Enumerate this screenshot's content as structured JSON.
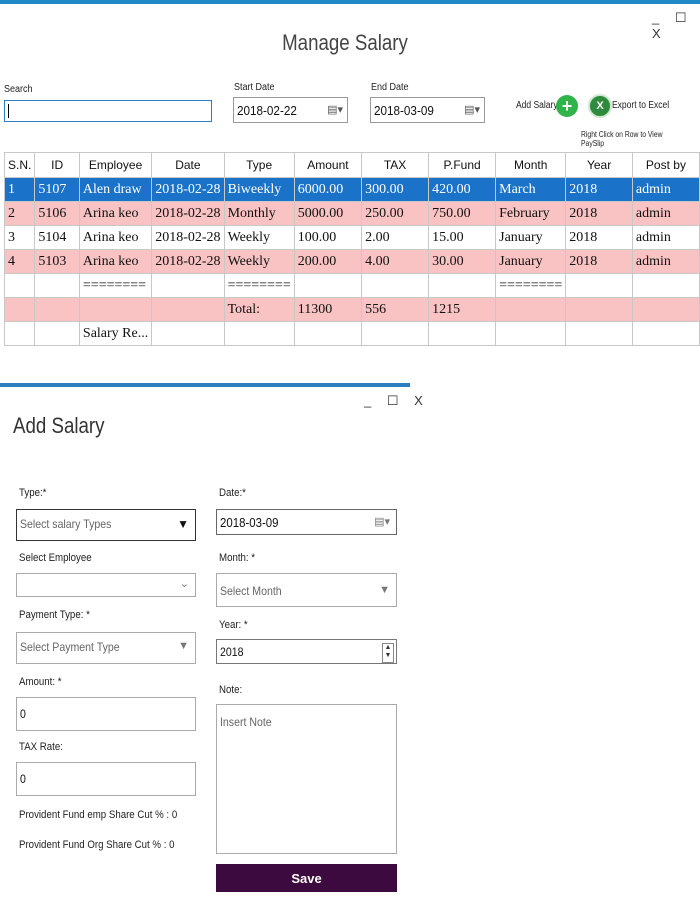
{
  "top_window": {
    "title": "Manage Salary",
    "controls": "_ ☐ X",
    "search_label": "Search",
    "search_value": "",
    "start_date_label": "Start Date",
    "start_date": "2018-02-22",
    "end_date_label": "End Date",
    "end_date": "2018-03-09",
    "add_salary_label": "Add Salary",
    "add_icon": "+",
    "export_icon": "X",
    "export_label": "Export to Excel",
    "hint": "Right Click on Row to View PaySlip"
  },
  "table": {
    "headers": [
      "S.N.",
      "ID",
      "Employee",
      "Date",
      "Type",
      "Amount",
      "TAX",
      "P.Fund",
      "Month",
      "Year",
      "Post by"
    ],
    "rows": [
      [
        "1",
        "5107",
        "Alen draw",
        "2018-02-28",
        "Biweekly",
        "6000.00",
        "300.00",
        "420.00",
        "March",
        "2018",
        "admin"
      ],
      [
        "2",
        "5106",
        "Arina keo",
        "2018-02-28",
        "Monthly",
        "5000.00",
        "250.00",
        "750.00",
        "February",
        "2018",
        "admin"
      ],
      [
        "3",
        "5104",
        "Arina keo",
        "2018-02-28",
        "Weekly",
        "100.00",
        "2.00",
        "15.00",
        "January",
        "2018",
        "admin"
      ],
      [
        "4",
        "5103",
        "Arina keo",
        "2018-02-28",
        "Weekly",
        "200.00",
        "4.00",
        "30.00",
        "January",
        "2018",
        "admin"
      ],
      [
        "",
        "",
        "========",
        "",
        "========",
        "",
        "",
        "",
        "========",
        "",
        ""
      ],
      [
        "",
        "",
        "",
        "",
        "Total:",
        "11300",
        "556",
        "1215",
        "",
        "",
        ""
      ],
      [
        "",
        "",
        "Salary Re...",
        "",
        "",
        "",
        "",
        "",
        "",
        "",
        ""
      ]
    ]
  },
  "add_window": {
    "title": "Add Salary",
    "controls": "_ ☐ X",
    "type_label": "Type:*",
    "type_placeholder": "Select salary Types",
    "employee_label": "Select Employee",
    "employee_value": "",
    "payment_label": "Payment Type: *",
    "payment_placeholder": "Select Payment Type",
    "amount_label": "Amount: *",
    "amount_value": "0",
    "tax_label": "TAX Rate:",
    "tax_value": "0",
    "pf_emp_label": "Provident Fund emp Share Cut % :",
    "pf_emp_value": "0",
    "pf_org_label": "Provident Fund Org Share Cut % :",
    "pf_org_value": "0",
    "date_label": "Date:*",
    "date_value": "2018-03-09",
    "month_label": "Month: *",
    "month_placeholder": "Select Month",
    "year_label": "Year: *",
    "year_value": "2018",
    "note_label": "Note:",
    "note_placeholder": "Insert Note",
    "save_label": "Save"
  }
}
